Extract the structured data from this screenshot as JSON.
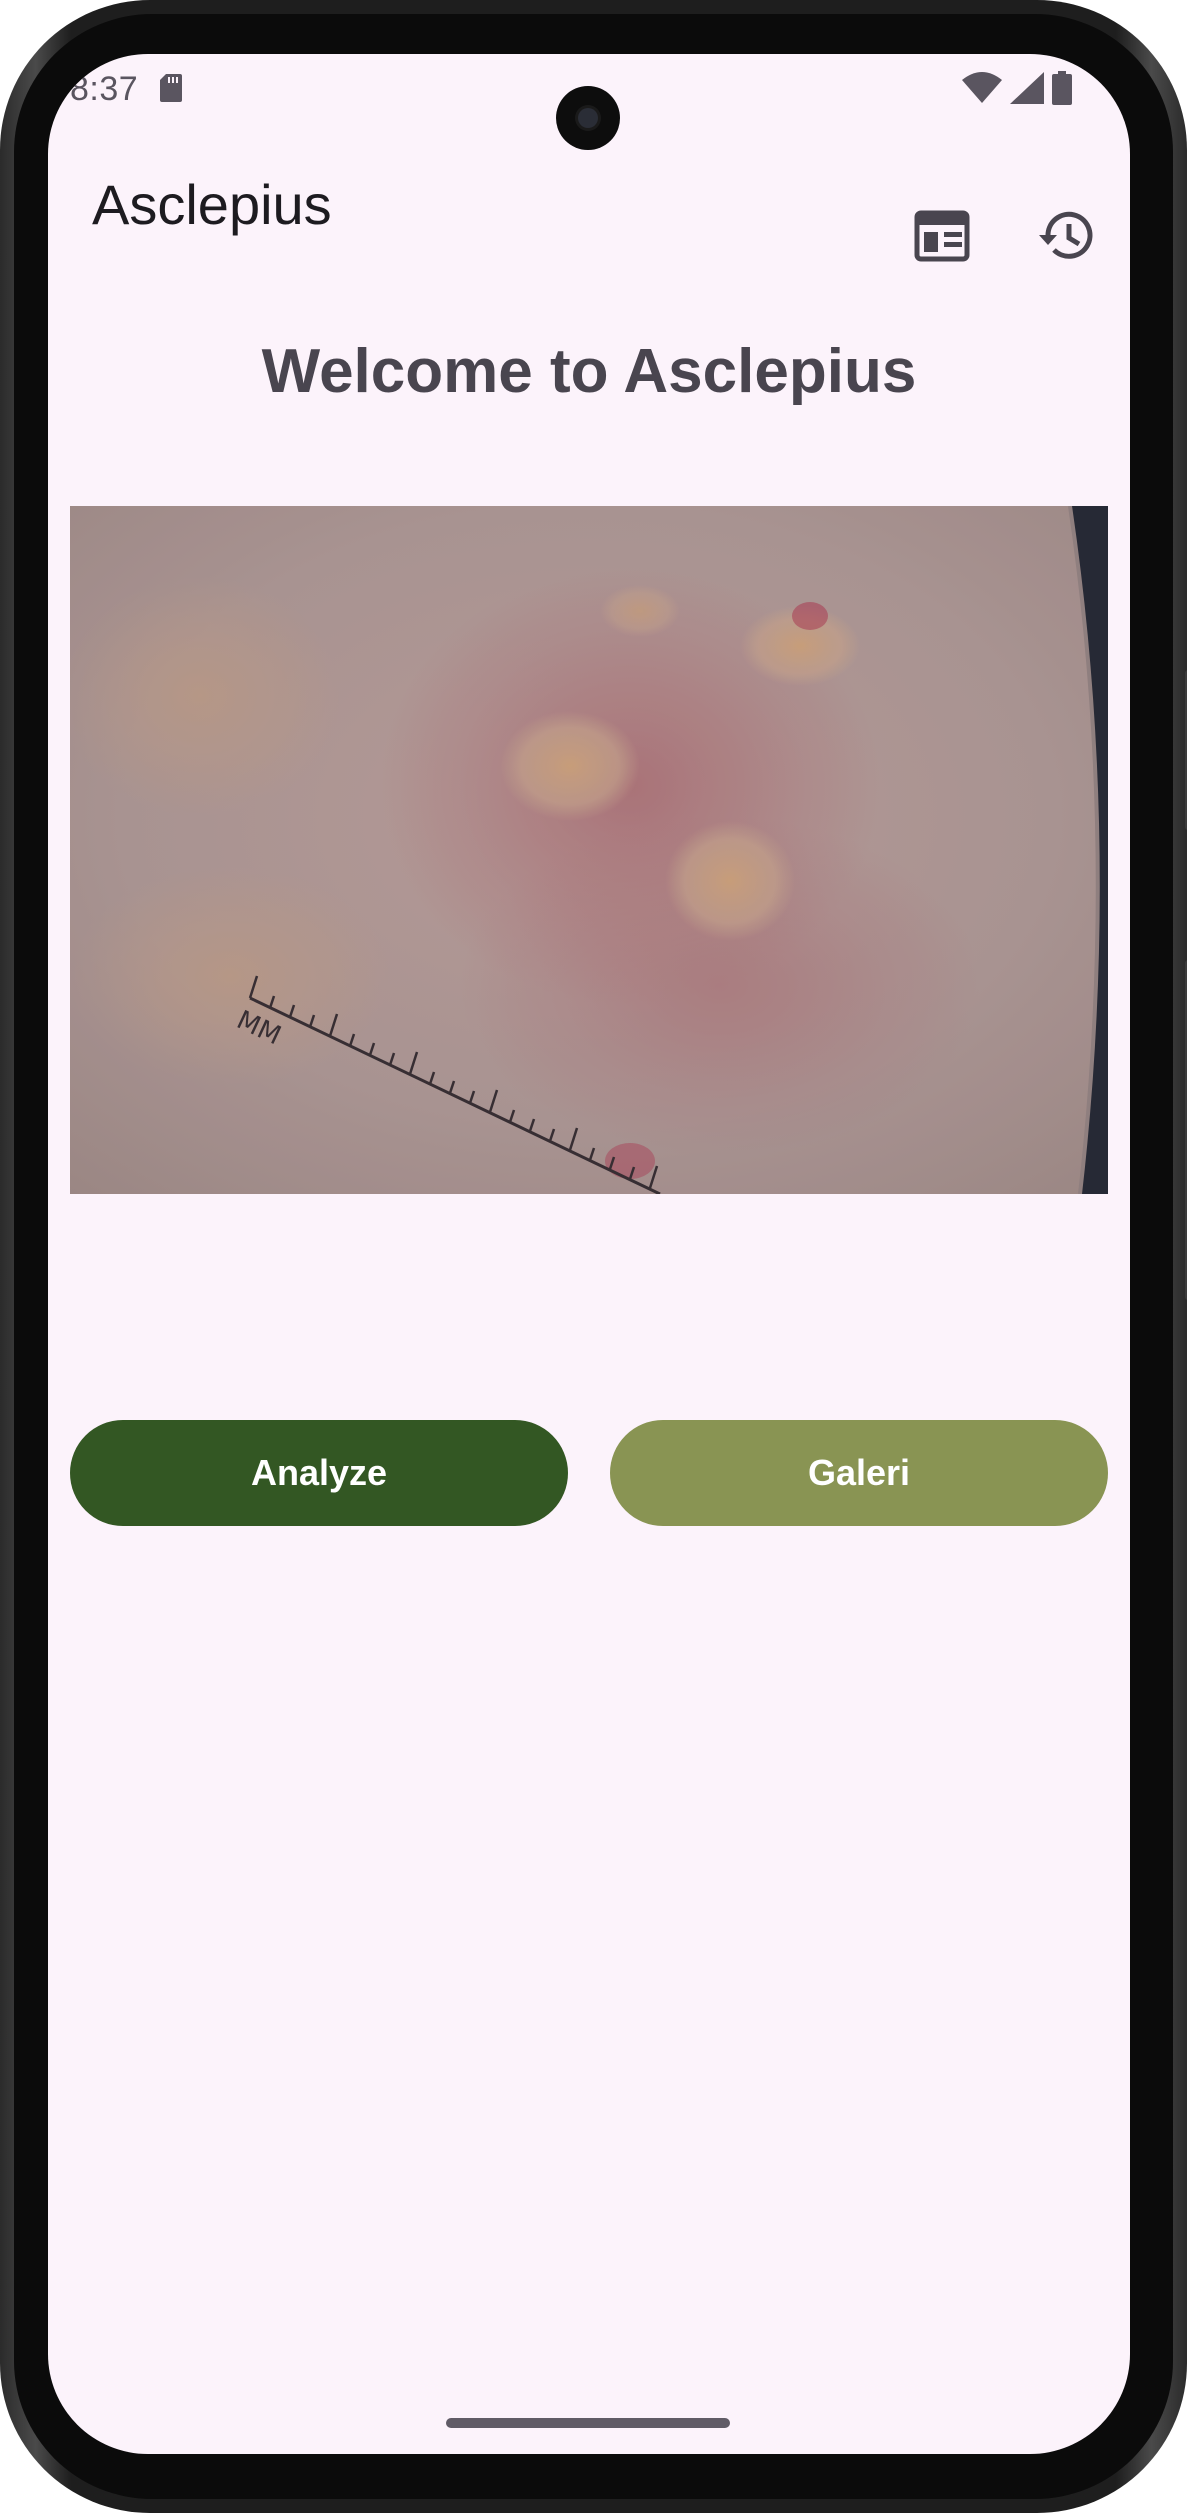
{
  "status_bar": {
    "time": "8:37",
    "icons": [
      "sd-card-icon",
      "wifi-icon",
      "cellular-signal-icon",
      "battery-icon"
    ]
  },
  "app_bar": {
    "title": "Asclepius",
    "actions": [
      "newspaper-icon",
      "history-icon"
    ]
  },
  "main": {
    "heading": "Welcome to Asclepius",
    "image_alt_semantic": "dermoscopy-image",
    "scale_label": "MM",
    "analyze_label": "Analyze",
    "gallery_label": "Galeri"
  },
  "colors": {
    "background": "#fcf3fb",
    "analyze_button": "#335723",
    "gallery_button": "#899453",
    "heading": "#49454f",
    "title": "#1d1b20"
  }
}
